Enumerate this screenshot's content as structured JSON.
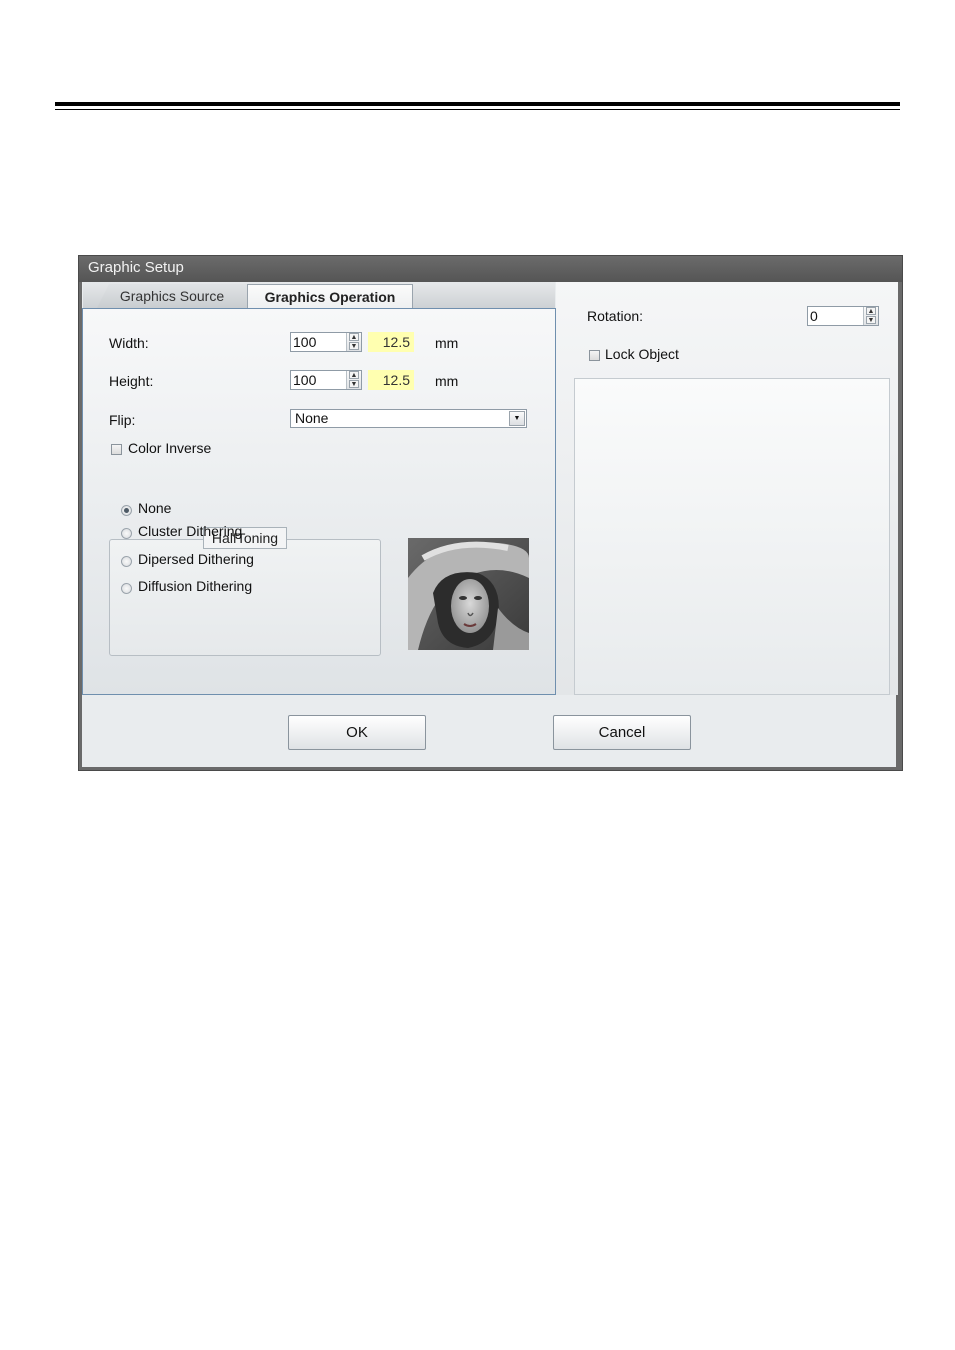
{
  "dialog": {
    "title": "Graphic Setup",
    "tabs": [
      {
        "label": "Graphics Source"
      },
      {
        "label": "Graphics Operation"
      }
    ],
    "width": {
      "label": "Width:",
      "value": "100",
      "mm_value": "12.5",
      "unit": "mm"
    },
    "height": {
      "label": "Height:",
      "value": "100",
      "mm_value": "12.5",
      "unit": "mm"
    },
    "flip": {
      "label": "Flip:",
      "selected": "None"
    },
    "color_inverse": {
      "label": "Color Inverse"
    },
    "halftoning": {
      "title": "HalfToning",
      "options": [
        {
          "label": "None"
        },
        {
          "label": "Cluster Dithering"
        },
        {
          "label": "Dipersed Dithering"
        },
        {
          "label": "Diffusion Dithering"
        }
      ],
      "selected": "None"
    },
    "rotation": {
      "label": "Rotation:",
      "value": "0"
    },
    "lock_object": {
      "label": "Lock Object"
    },
    "buttons": {
      "ok": "OK",
      "cancel": "Cancel"
    }
  }
}
